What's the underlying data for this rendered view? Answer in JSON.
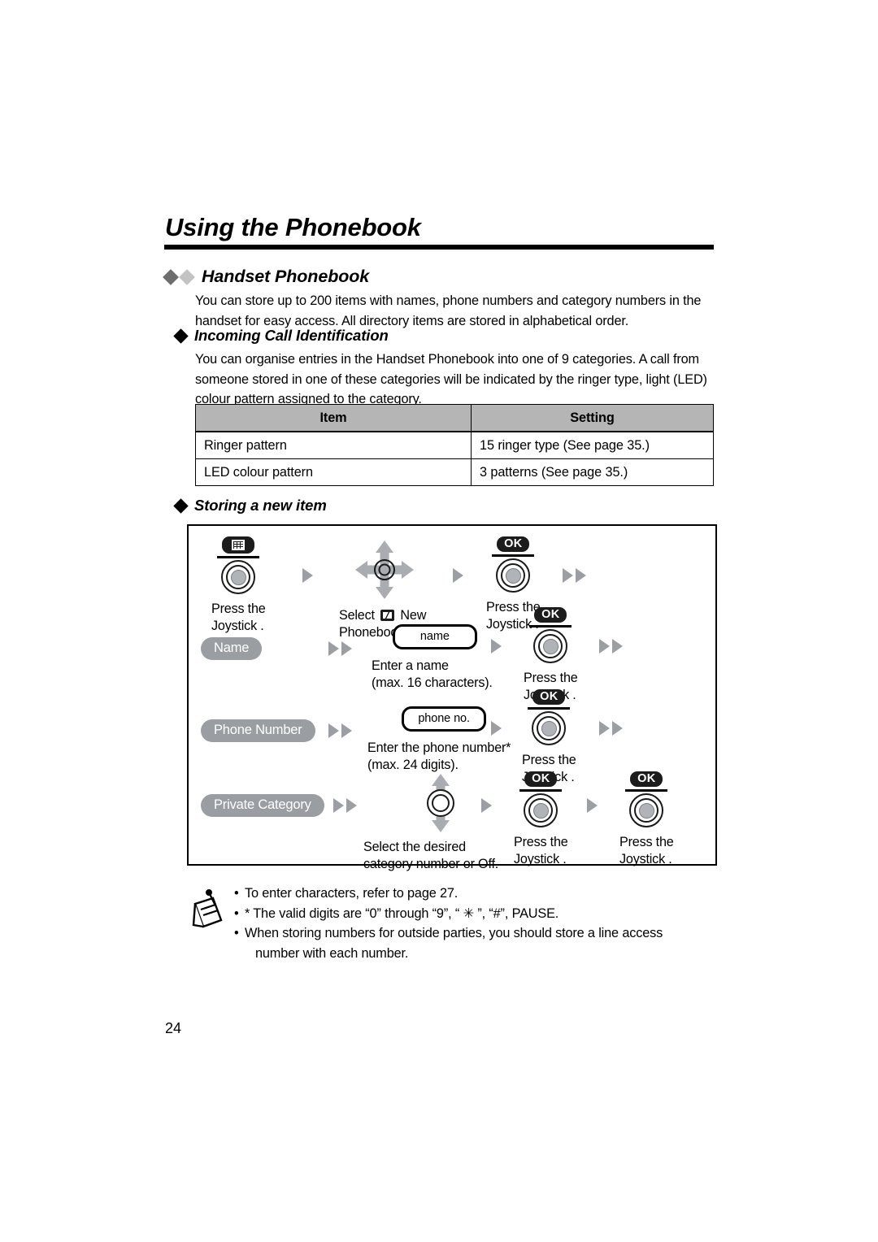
{
  "page": {
    "number": "24",
    "chapter_title": "Using the Phonebook"
  },
  "sections": {
    "handset_phonebook": {
      "heading": "Handset Phonebook",
      "body": "You can store up to 200 items with names, phone numbers and category numbers in the handset for easy access. All directory items are stored in alphabetical order."
    },
    "incoming_call_identification": {
      "heading": "Incoming Call Identification",
      "body": "You can organise entries in the Handset Phonebook into one of 9 categories. A call from someone stored in one of these categories will be indicated by the ringer type, light (LED) colour pattern assigned to the category."
    },
    "storing_a_new_item": {
      "heading": "Storing a new item"
    }
  },
  "table": {
    "headers": [
      "Item",
      "Setting"
    ],
    "rows": [
      [
        "Ringer pattern",
        "15 ringer type (See page 35.)"
      ],
      [
        "LED colour pattern",
        "3 patterns (See page 35.)"
      ]
    ]
  },
  "flow": {
    "row1": {
      "step1": {
        "button_label": "menu-pill",
        "caption_line1": "Press the",
        "caption_line2": "Joystick ."
      },
      "step2": {
        "caption_pre": "Select",
        "caption_icon": "phonebook-icon",
        "caption_post": "New",
        "caption_line2": "Phonebook ."
      },
      "step3": {
        "button_label": "OK",
        "caption_line1": "Press the",
        "caption_line2": "Joystick ."
      }
    },
    "row2": {
      "pill": "Name",
      "field": "name",
      "caption_line1": "Enter a name",
      "caption_line2": "(max. 16 characters).",
      "step": {
        "button_label": "OK",
        "caption_line1": "Press the",
        "caption_line2": "Joystick ."
      }
    },
    "row3": {
      "pill": "Phone Number",
      "field": "phone no.",
      "caption_line1": "Enter the phone number*",
      "caption_line2": "(max. 24 digits).",
      "step": {
        "button_label": "OK",
        "caption_line1": "Press the",
        "caption_line2": "Joystick ."
      }
    },
    "row4": {
      "pill": "Private Category",
      "caption_line1": "Select the desired",
      "caption_line2": "category number   or Off.",
      "step1": {
        "button_label": "OK",
        "caption_line1": "Press the",
        "caption_line2": "Joystick ."
      },
      "step2": {
        "button_label": "OK",
        "caption_line1": "Press the",
        "caption_line2": "Joystick ."
      }
    }
  },
  "notes": [
    "To enter characters, refer to page 27.",
    "* The valid digits are “0” through “9”, “ ✳ ”, “#”, PAUSE.",
    "When storing numbers for outside parties, you should store a line access",
    "number with each number."
  ],
  "colors": {
    "table_header_bg": "#b5b5b5",
    "pill_gray": "#9a9ea2",
    "arrow_gray": "#9b9fa3",
    "diamond_dark": "#6e6e6e",
    "diamond_light": "#c3c3c3",
    "ink": "#000000"
  }
}
